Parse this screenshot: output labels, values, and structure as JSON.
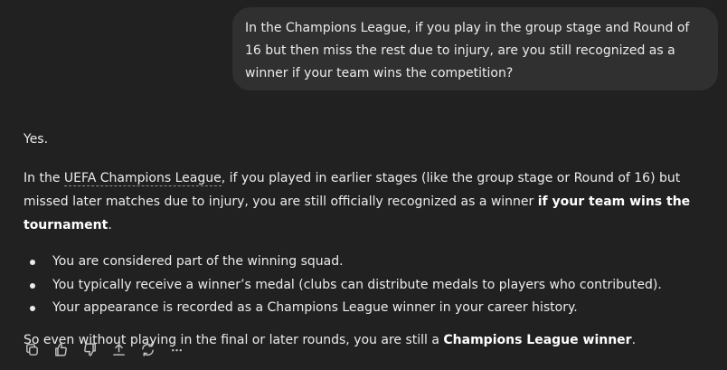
{
  "user_message": {
    "text": "In the Champions League, if you play in the group stage and Round of 16 but then miss the rest due to injury, are you still recognized as a winner if your team wins the competition?"
  },
  "assistant_message": {
    "short_answer": "Yes.",
    "intro": {
      "before_link": "In the ",
      "link_text": "UEFA Champions League",
      "after_link": ", if you played in earlier stages (like the group stage or Round of 16) but missed later matches due to injury, you are still officially recognized as a winner ",
      "bold": "if your team wins the tournament",
      "end": "."
    },
    "bullets": [
      "You are considered part of the winning squad.",
      "You typically receive a winner’s medal (clubs can distribute medals to players who contributed).",
      "Your appearance is recorded as a Champions League winner in your career history."
    ],
    "conclusion": {
      "before_bold": "So even without playing in the final or later rounds, you are still a ",
      "bold": "Champions League winner",
      "end": "."
    }
  },
  "actions": {
    "icons": [
      "copy-icon",
      "thumbs-up-icon",
      "thumbs-down-icon",
      "share-icon",
      "regenerate-icon",
      "more-icon"
    ],
    "icon_color": "#c4c4c4"
  },
  "colors": {
    "background": "#212121",
    "bubble": "#303030",
    "text": "#ececec"
  }
}
